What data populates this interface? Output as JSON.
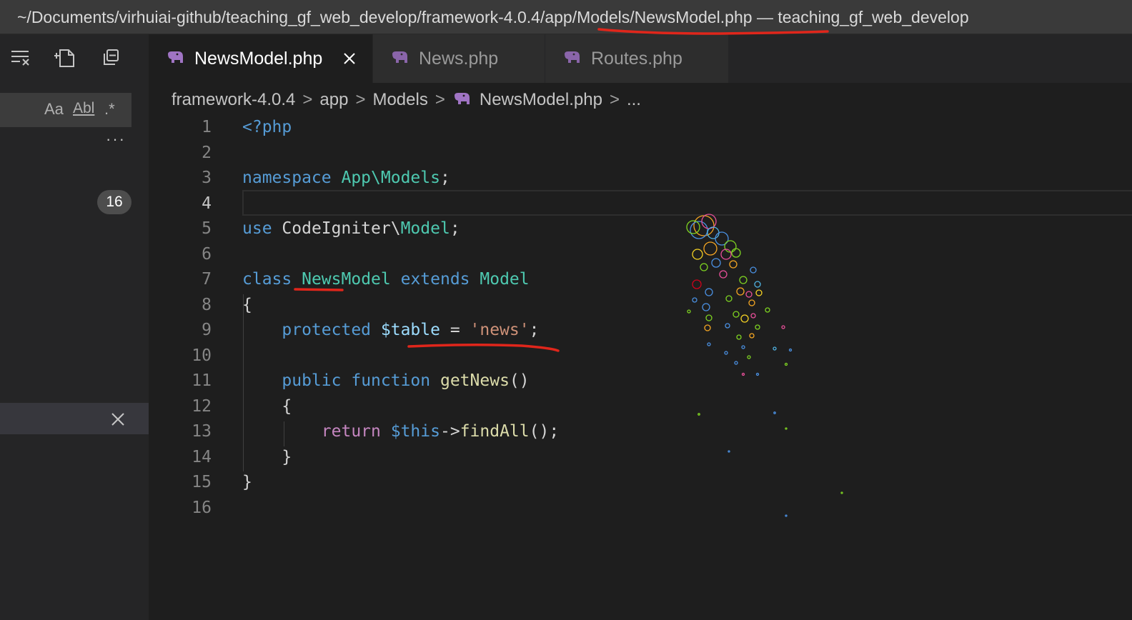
{
  "window": {
    "title": "~/Documents/virhuiai-github/teaching_gf_web_develop/framework-4.0.4/app/Models/NewsModel.php — teaching_gf_web_develop"
  },
  "sidebar": {
    "icons": [
      "collapse-results-icon",
      "new-file-icon",
      "collapse-all-icon"
    ],
    "search_options": {
      "match_case": "Aa",
      "whole_word": "Abl",
      "regex": ".*"
    },
    "more": "···",
    "result_count": "16"
  },
  "tabs": [
    {
      "label": "NewsModel.php",
      "active": true,
      "icon": "php-elephant-icon"
    },
    {
      "label": "News.php",
      "active": false,
      "icon": "php-elephant-icon"
    },
    {
      "label": "Routes.php",
      "active": false,
      "icon": "php-elephant-icon"
    }
  ],
  "breadcrumb": {
    "parts": [
      "framework-4.0.4",
      "app",
      "Models",
      "NewsModel.php",
      "..."
    ],
    "separator": ">"
  },
  "editor": {
    "current_line": "4",
    "line_numbers": [
      "1",
      "2",
      "3",
      "4",
      "5",
      "6",
      "7",
      "8",
      "9",
      "10",
      "11",
      "12",
      "13",
      "14",
      "15",
      "16"
    ],
    "tokens": {
      "l1_open": "<?php",
      "l3_namespace": "namespace",
      "l3_name": "App\\Models",
      "l3_semi": ";",
      "l5_use": "use",
      "l5_ns": "CodeIgniter\\",
      "l5_class": "Model",
      "l5_semi": ";",
      "l7_class": "class",
      "l7_name": "NewsModel",
      "l7_extends": "extends",
      "l7_parent": "Model",
      "l8_brace": "{",
      "l9_indent": "    ",
      "l9_protected": "protected",
      "l9_var": "$table",
      "l9_eq": " = ",
      "l9_str": "'news'",
      "l9_semi": ";",
      "l11_indent": "    ",
      "l11_public": "public",
      "l11_function": "function",
      "l11_name": "getNews",
      "l11_parens": "()",
      "l12_brace": "    {",
      "l13_indent": "        ",
      "l13_return": "return",
      "l13_this": "$this",
      "l13_arrow": "->",
      "l13_call": "findAll",
      "l13_end": "();",
      "l14_brace": "    }",
      "l15_brace": "}"
    }
  },
  "colors": {
    "keyword": "#569cd6",
    "control": "#c586c0",
    "type": "#4ec9b0",
    "function": "#dcdcaa",
    "variable": "#9cdcfe",
    "string": "#ce9178",
    "annotation": "#e0261b"
  }
}
